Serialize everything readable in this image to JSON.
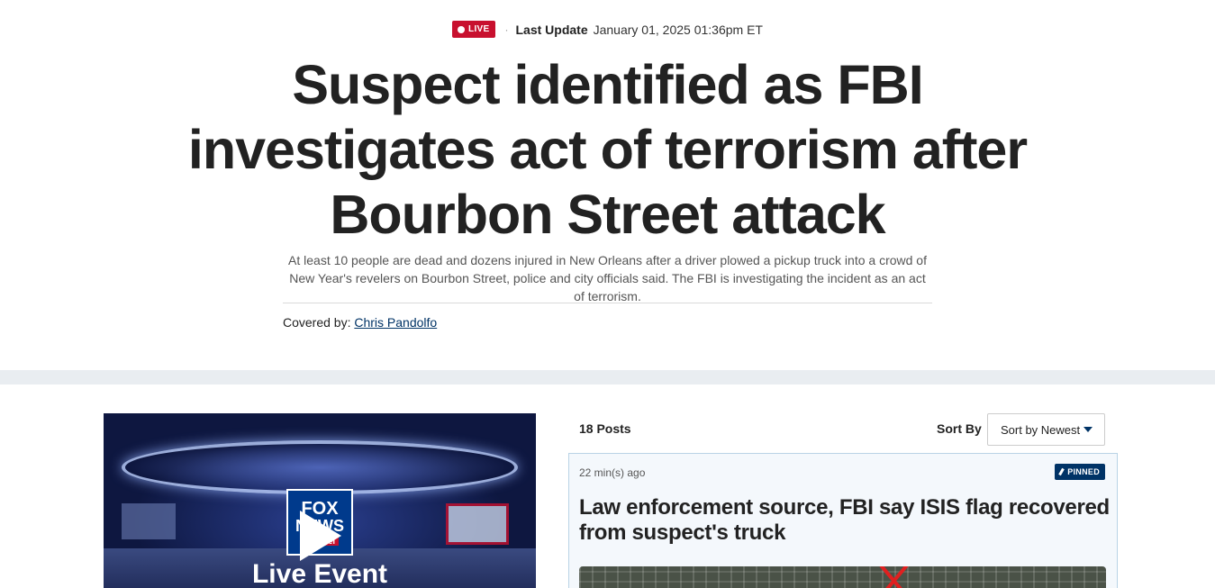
{
  "header": {
    "live_label": "LIVE",
    "last_update_label": "Last Update",
    "last_update_time": "January 01, 2025 01:36pm ET"
  },
  "article": {
    "headline": "Suspect identified as FBI investigates act of terrorism after Bourbon Street attack",
    "summary": "At least 10 people are dead and dozens injured in New Orleans after a driver plowed a pickup truck into a crowd of New Year's revelers on Bourbon Street, police and city officials said. The FBI is investigating the incident as an act of terrorism.",
    "covered_by_label": "Covered by:",
    "author": "Chris Pandolfo"
  },
  "video": {
    "logo_line1": "FOX",
    "logo_line2": "NEWS",
    "logo_line3": "channel",
    "title": "Live Event"
  },
  "feed": {
    "posts_count": "18 Posts",
    "sort_label": "Sort By",
    "sort_value": "Sort by Newest",
    "posts": [
      {
        "time": "22 min(s) ago",
        "badge": "PINNED",
        "title": "Law enforcement source, FBI say ISIS flag recovered from suspect's truck"
      }
    ]
  },
  "colors": {
    "live_red": "#c8102e",
    "navy": "#003366",
    "band": "#e9edf1"
  }
}
